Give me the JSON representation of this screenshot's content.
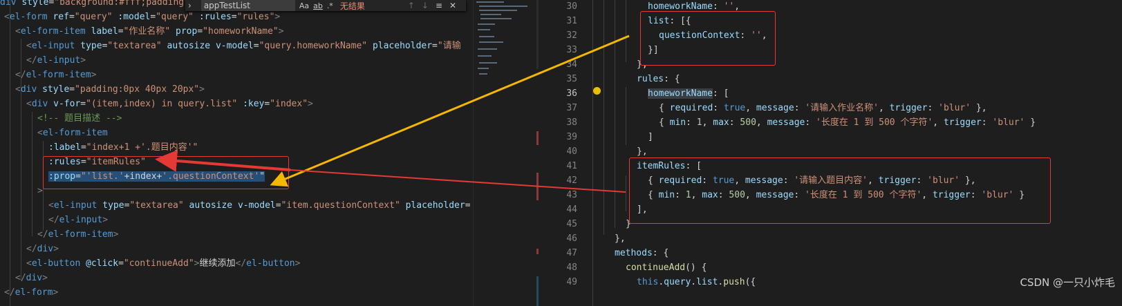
{
  "find_widget": {
    "query": "appTestList",
    "opt_case": "Aa",
    "opt_word": "ab",
    "opt_regex": ".*",
    "result": "无结果",
    "icons": [
      "arrow-up-icon",
      "arrow-down-icon",
      "selection-icon",
      "close-icon"
    ]
  },
  "left_lines": [
    "div style=\"background:#fff;padding",
    "<el-form ref=\"query\" :model=\"query\" :rules=\"rules\">",
    "  <el-form-item label=\"作业名称\" prop=\"homeworkName\">",
    "    <el-input type=\"textarea\" autosize v-model=\"query.homeworkName\" placeholder=\"请输",
    "    </el-input>",
    "  </el-form-item>",
    "  <div style=\"padding:0px 40px 20px\">",
    "    <div v-for=\"(item,index) in query.list\" :key=\"index\">",
    "      <!-- 题目描述 -->",
    "      <el-form-item",
    "        :label=\"index+1 +'.题目内容'\"",
    "        :rules=\"itemRules\"",
    "        :prop=\"'list.'+index+'.questionContext'\"",
    "      >",
    "        <el-input type=\"textarea\" autosize v-model=\"item.questionContext\" placeholder=",
    "        </el-input>",
    "      </el-form-item>",
    "    </div>",
    "    <el-button @click=\"continueAdd\">继续添加</el-button>",
    "  </div>",
    "</el-form>"
  ],
  "right_line_numbers": [
    "30",
    "31",
    "32",
    "33",
    "34",
    "35",
    "36",
    "37",
    "38",
    "39",
    "40",
    "41",
    "42",
    "43",
    "44",
    "45",
    "46",
    "47",
    "48",
    "49"
  ],
  "right_lines": [
    "        homeworkName: '',",
    "        list: [{",
    "          questionContext: '',",
    "        }]",
    "      },",
    "      rules: {",
    "        homeworkName: [",
    "          { required: true, message: '请输入作业名称', trigger: 'blur' },",
    "          { min: 1, max: 500, message: '长度在 1 到 500 个字符', trigger: 'blur' }",
    "        ]",
    "      },",
    "      itemRules: [",
    "        { required: true, message: '请输入题目内容', trigger: 'blur' },",
    "        { min: 1, max: 500, message: '长度在 1 到 500 个字符', trigger: 'blur' }",
    "      ],",
    "    }",
    "  },",
    "  methods: {",
    "    continueAdd() {",
    "      this.query.list.push({"
  ],
  "active_line": "36",
  "watermark": "CSDN @一只小炸毛",
  "colors": {
    "arrow_yellow": "#f5b800",
    "arrow_red": "#e53935",
    "box_red": "#e53935",
    "selection": "#264f78"
  }
}
